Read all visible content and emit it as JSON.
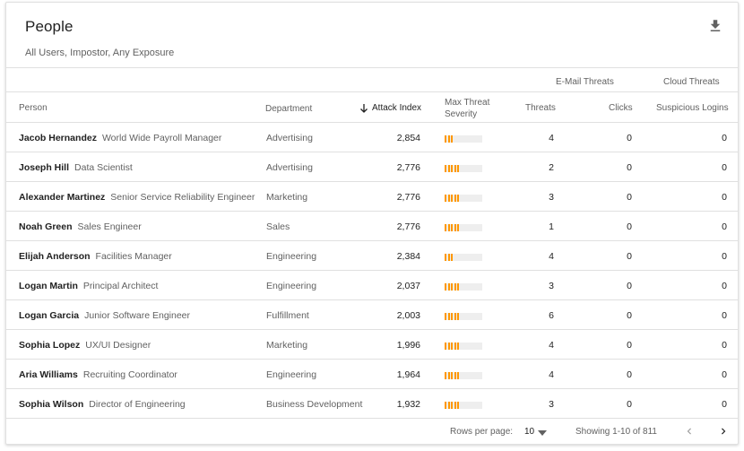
{
  "header": {
    "title": "People",
    "subtitle": "All Users, Impostor, Any Exposure"
  },
  "groups": {
    "email": "E-Mail Threats",
    "cloud": "Cloud Threats"
  },
  "columns": {
    "person": "Person",
    "department": "Department",
    "attack_index": "Attack Index",
    "severity_1": "Max Threat",
    "severity_2": "Severity",
    "threats": "Threats",
    "clicks": "Clicks",
    "logins": "Suspicious Logins"
  },
  "colors": {
    "severity_fill": "#ff9800",
    "severity_track": "#eeeeee"
  },
  "rows": [
    {
      "name": "Jacob Hernandez",
      "role": "World Wide Payroll Manager",
      "dept": "Advertising",
      "index": "2,854",
      "severity": 3,
      "threats": "4",
      "clicks": "0",
      "logins": "0"
    },
    {
      "name": "Joseph Hill",
      "role": "Data Scientist",
      "dept": "Advertising",
      "index": "2,776",
      "severity": 5,
      "threats": "2",
      "clicks": "0",
      "logins": "0"
    },
    {
      "name": "Alexander Martinez",
      "role": "Senior Service Reliability Engineer",
      "dept": "Marketing",
      "index": "2,776",
      "severity": 5,
      "threats": "3",
      "clicks": "0",
      "logins": "0"
    },
    {
      "name": "Noah Green",
      "role": "Sales Engineer",
      "dept": "Sales",
      "index": "2,776",
      "severity": 5,
      "threats": "1",
      "clicks": "0",
      "logins": "0"
    },
    {
      "name": "Elijah Anderson",
      "role": "Facilities Manager",
      "dept": "Engineering",
      "index": "2,384",
      "severity": 3,
      "threats": "4",
      "clicks": "0",
      "logins": "0"
    },
    {
      "name": "Logan Martin",
      "role": "Principal Architect",
      "dept": "Engineering",
      "index": "2,037",
      "severity": 5,
      "threats": "3",
      "clicks": "0",
      "logins": "0"
    },
    {
      "name": "Logan Garcia",
      "role": "Junior Software Engineer",
      "dept": "Fulfillment",
      "index": "2,003",
      "severity": 5,
      "threats": "6",
      "clicks": "0",
      "logins": "0"
    },
    {
      "name": "Sophia Lopez",
      "role": "UX/UI Designer",
      "dept": "Marketing",
      "index": "1,996",
      "severity": 5,
      "threats": "4",
      "clicks": "0",
      "logins": "0"
    },
    {
      "name": "Aria Williams",
      "role": "Recruiting Coordinator",
      "dept": "Engineering",
      "index": "1,964",
      "severity": 5,
      "threats": "4",
      "clicks": "0",
      "logins": "0"
    },
    {
      "name": "Sophia Wilson",
      "role": "Director of Engineering",
      "dept": "Business Development",
      "index": "1,932",
      "severity": 5,
      "threats": "3",
      "clicks": "0",
      "logins": "0"
    }
  ],
  "footer": {
    "rows_per_page_label": "Rows per page:",
    "rows_per_page_value": "10",
    "showing": "Showing 1-10 of 811"
  },
  "icons": {
    "download": "download-icon",
    "sort": "arrow-down-icon",
    "caret": "caret-down-icon",
    "prev": "chevron-left-icon",
    "next": "chevron-right-icon"
  }
}
